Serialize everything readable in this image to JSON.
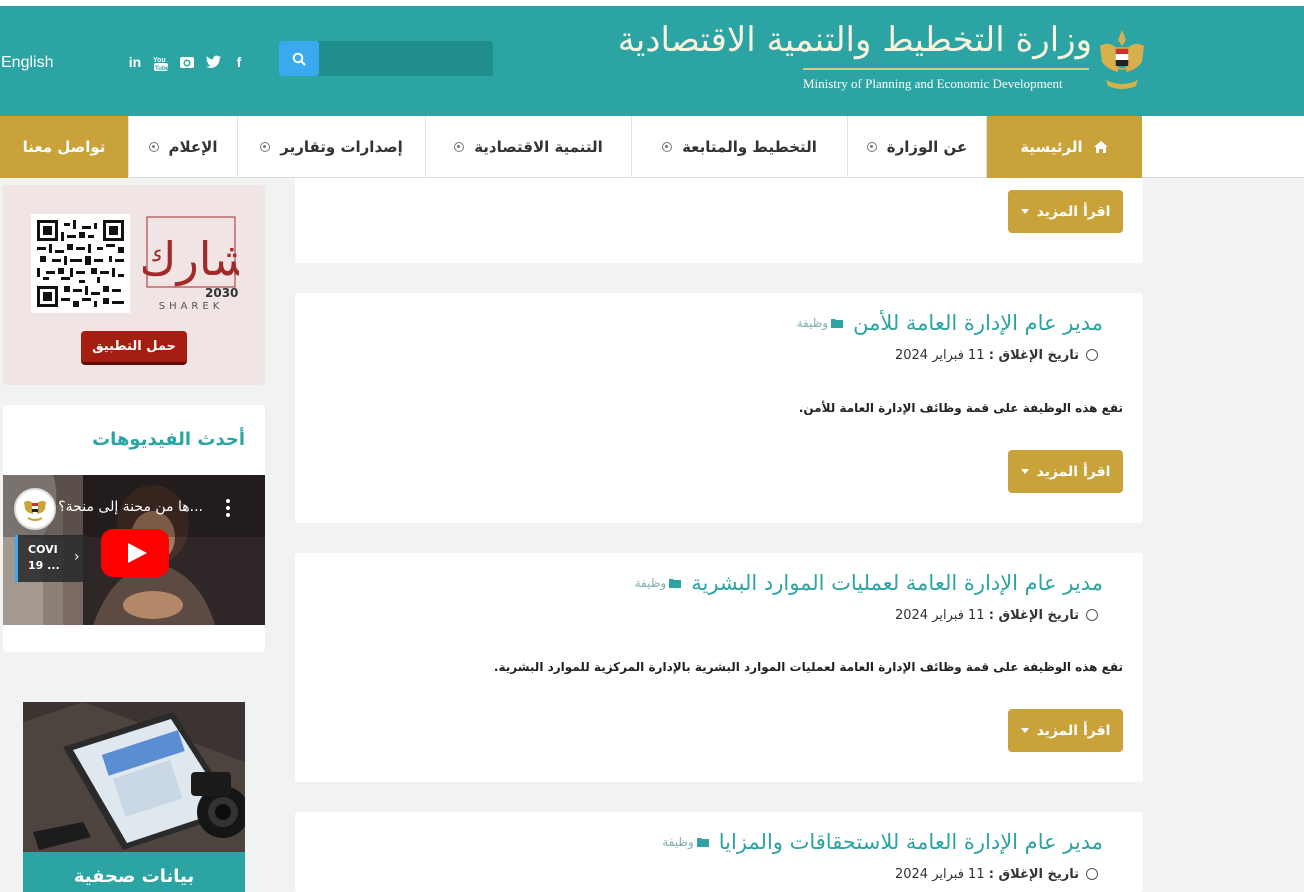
{
  "header": {
    "language_link": "English",
    "search": {
      "placeholder": ""
    },
    "social": [
      "in",
      "You Tube",
      "instagram",
      "twitter",
      "f"
    ],
    "logo_ar": "وزارة التخطيط والتنمية الاقتصادية",
    "logo_en": "Ministry of Planning and Economic Development"
  },
  "nav": {
    "home": "الرئيسية",
    "about": "عن الوزارة",
    "planning": "التخطيط والمتابعة",
    "economic": "التنمية الاقتصادية",
    "publications": "إصدارات وتقارير",
    "media": "الإعلام",
    "contact": "تواصل معنا"
  },
  "sidebar": {
    "sharek": {
      "brand_ar": "شارك",
      "year": "2030",
      "brand_en": "SHAREK",
      "download_btn": "حمل التطبيق"
    },
    "videos": {
      "heading": "أحدث الفيديوهات",
      "video_title": "...ها من محنة إلى منحة؟",
      "badge_line1": "COVI",
      "badge_line2": "19 ..."
    },
    "press": {
      "title": "بيانات صحفية"
    }
  },
  "posts": [
    {
      "title": "",
      "category": "",
      "date_label": "",
      "date_value": "",
      "excerpt": "",
      "more": "اقرأ المزيد"
    },
    {
      "title": "مدير عام الإدارة العامة للأمن",
      "category": "وظيفة",
      "date_label": "تاريخ الإغلاق :",
      "date_value": "11 فبراير 2024",
      "excerpt": "تقع هذه الوظيفة على قمة وظائف الإدارة العامة للأمن.",
      "more": "اقرأ المزيد"
    },
    {
      "title": "مدير عام الإدارة العامة لعمليات الموارد البشرية",
      "category": "وظيفة",
      "date_label": "تاريخ الإغلاق :",
      "date_value": "11 فبراير 2024",
      "excerpt": "تقع هذه الوظيفة على قمة وظائف الإدارة العامة لعمليات الموارد البشرية بالإدارة المركزية للموارد البشرية.",
      "more": "اقرأ المزيد"
    },
    {
      "title": "مدير عام الإدارة العامة للاستحقاقات والمزايا",
      "category": "وظيفة",
      "date_label": "تاريخ الإغلاق :",
      "date_value": "11 فبراير 2024",
      "excerpt": "",
      "more": ""
    }
  ]
}
